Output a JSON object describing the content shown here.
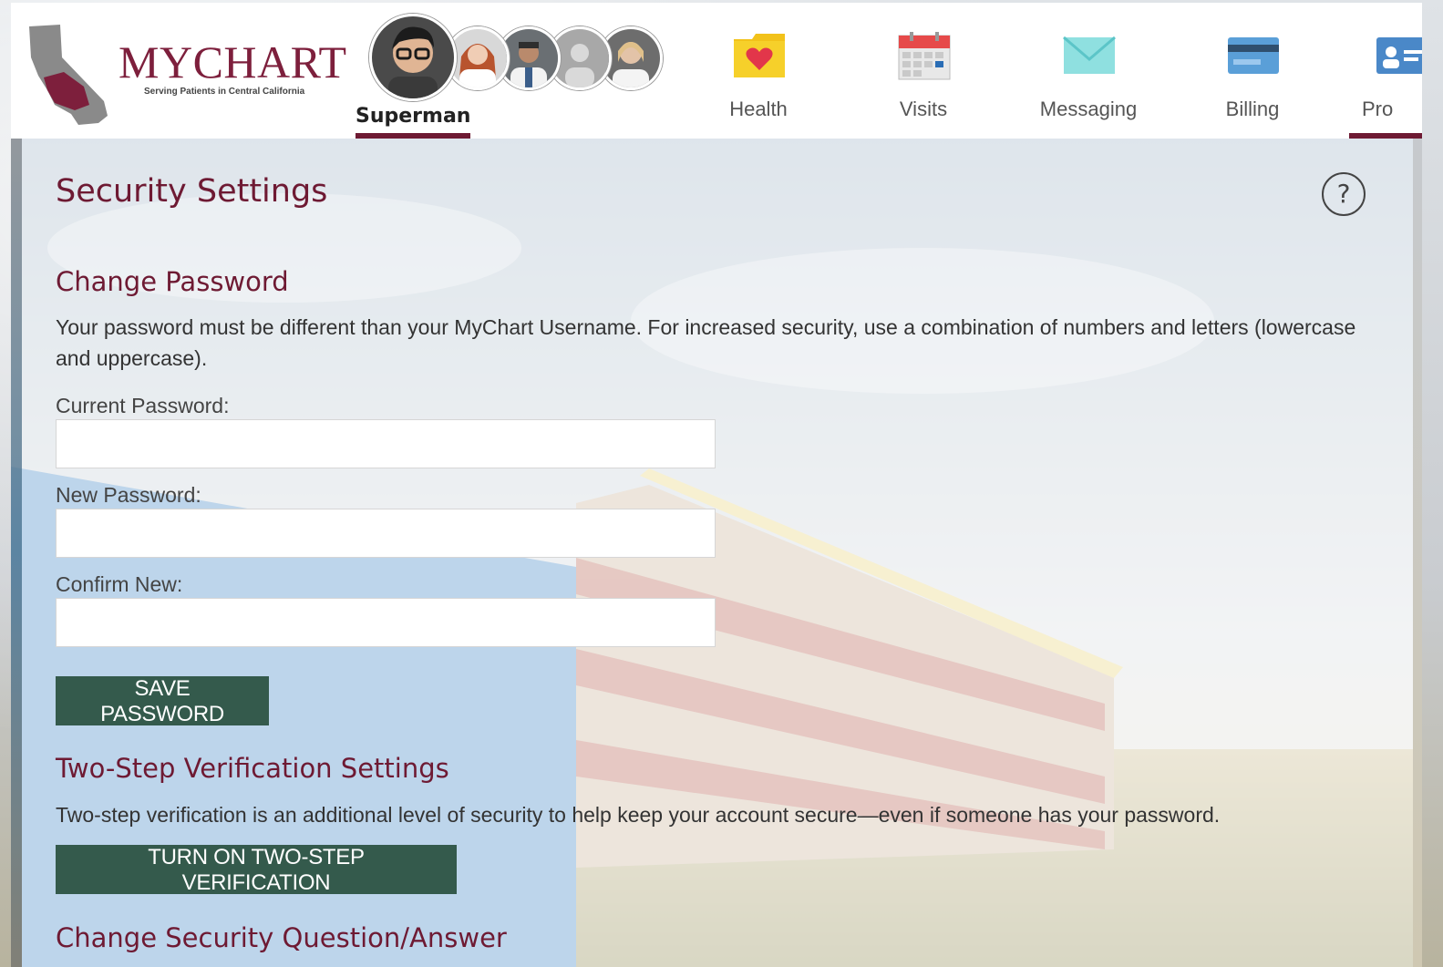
{
  "header": {
    "brand": "MYCHART",
    "tagline": "Serving Patients in Central California",
    "active_user": "Superman",
    "nav": [
      {
        "label": "Health",
        "icon": "heart-folder-icon"
      },
      {
        "label": "Visits",
        "icon": "calendar-icon"
      },
      {
        "label": "Messaging",
        "icon": "envelope-icon"
      },
      {
        "label": "Billing",
        "icon": "credit-card-icon"
      },
      {
        "label": "Pro",
        "icon": "profile-card-icon"
      }
    ]
  },
  "page": {
    "title": "Security Settings",
    "help_glyph": "?"
  },
  "change_password": {
    "heading": "Change Password",
    "description": "Your password must be different than your MyChart Username. For increased security, use a combination of numbers and letters (lowercase and uppercase).",
    "current_label": "Current Password:",
    "current_value": "",
    "new_label": "New Password:",
    "new_value": "",
    "confirm_label": "Confirm New:",
    "confirm_value": "",
    "save_label": "SAVE PASSWORD"
  },
  "two_step": {
    "heading": "Two-Step Verification Settings",
    "description": "Two-step verification is an additional level of security to help keep your account secure—even if someone has your password.",
    "button_label": "TURN ON TWO-STEP VERIFICATION"
  },
  "security_question": {
    "heading": "Change Security Question/Answer"
  },
  "colors": {
    "brand": "#6e1a33",
    "button": "#345a4c"
  }
}
